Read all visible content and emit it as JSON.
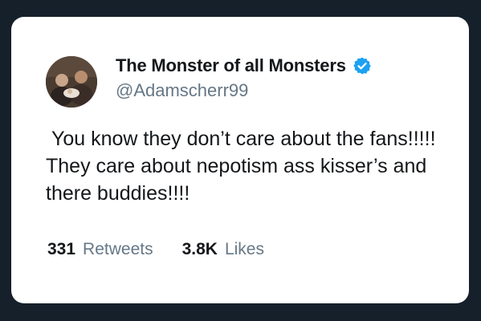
{
  "tweet": {
    "display_name": "The Monster of all Monsters",
    "handle": "@Adamscherr99",
    "verified_icon": "verified-badge-icon",
    "text": " You know they don’t care about the fans!!!!!   They care about nepotism ass kisser’s and there buddies!!!!",
    "retweets_count": "331",
    "retweets_label": "Retweets",
    "likes_count": "3.8K",
    "likes_label": "Likes"
  },
  "colors": {
    "background": "#15202b",
    "card": "#ffffff",
    "text_primary": "#14171a",
    "text_secondary": "#657786",
    "verified_blue": "#1da1f2"
  }
}
